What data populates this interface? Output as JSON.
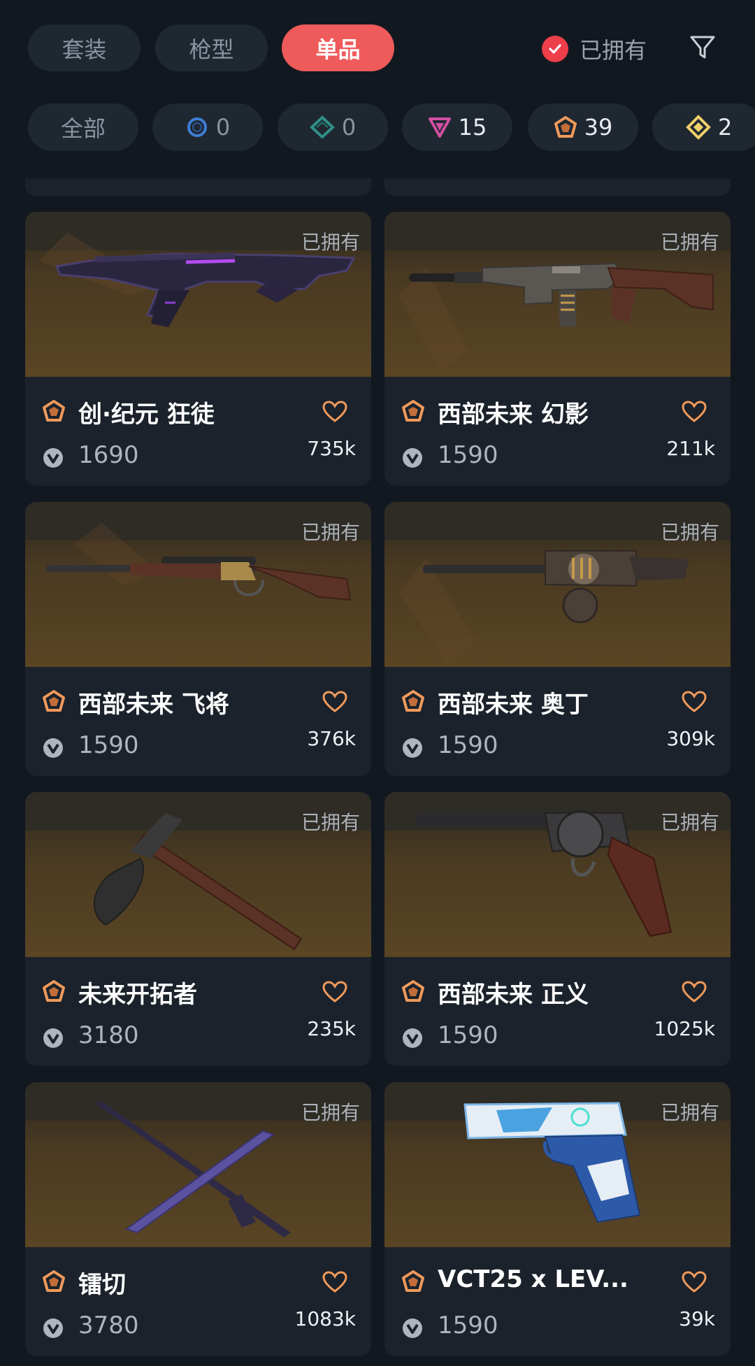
{
  "tabs": [
    {
      "label": "套装",
      "active": false
    },
    {
      "label": "枪型",
      "active": false
    },
    {
      "label": "单品",
      "active": true
    }
  ],
  "owned_filter": {
    "label": "已拥有",
    "checked": true
  },
  "filter_icon": "filter-funnel-icon",
  "rarity_chips": [
    {
      "label": "全部",
      "icon": null
    },
    {
      "count": "0",
      "icon": "select-tier-icon",
      "color": "#3d7fd6"
    },
    {
      "count": "0",
      "icon": "deluxe-tier-icon",
      "color": "#2f8f86"
    },
    {
      "count": "15",
      "icon": "premium-tier-icon",
      "color": "#d04fa0"
    },
    {
      "count": "39",
      "icon": "exclusive-tier-icon",
      "color": "#f09a5b"
    },
    {
      "count": "2",
      "icon": "ultra-tier-icon",
      "color": "#f2d06a"
    }
  ],
  "skins": [
    {
      "owned_label": "已拥有",
      "name": "创·纪元 狂徒",
      "price": "1690",
      "likes": "735k",
      "tier_color": "#f09a5b"
    },
    {
      "owned_label": "已拥有",
      "name": "西部未来 幻影",
      "price": "1590",
      "likes": "211k",
      "tier_color": "#f09a5b"
    },
    {
      "owned_label": "已拥有",
      "name": "西部未来 飞将",
      "price": "1590",
      "likes": "376k",
      "tier_color": "#f09a5b"
    },
    {
      "owned_label": "已拥有",
      "name": "西部未来 奥丁",
      "price": "1590",
      "likes": "309k",
      "tier_color": "#f09a5b"
    },
    {
      "owned_label": "已拥有",
      "name": "未来开拓者",
      "price": "3180",
      "likes": "235k",
      "tier_color": "#f09a5b"
    },
    {
      "owned_label": "已拥有",
      "name": "西部未来 正义",
      "price": "1590",
      "likes": "1025k",
      "tier_color": "#f09a5b"
    },
    {
      "owned_label": "已拥有",
      "name": "镭切",
      "price": "3780",
      "likes": "1083k",
      "tier_color": "#f09a5b"
    },
    {
      "owned_label": "已拥有",
      "name": "VCT25 x LEV...",
      "price": "1590",
      "likes": "39k",
      "tier_color": "#f09a5b"
    }
  ]
}
